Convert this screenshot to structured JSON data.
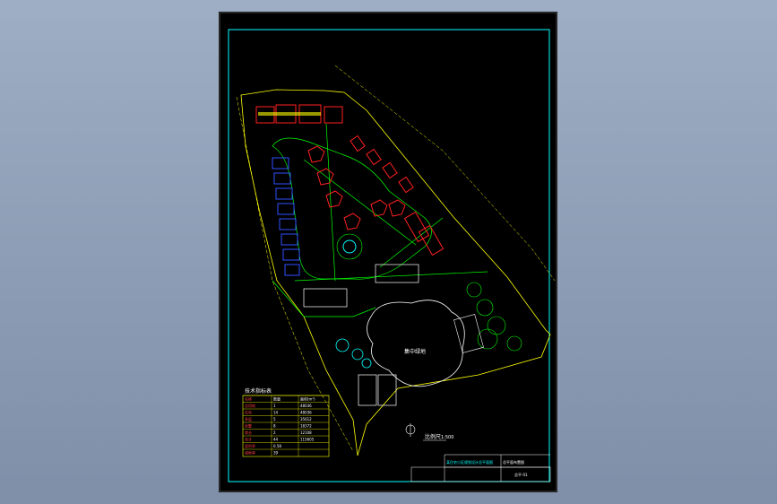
{
  "drawing": {
    "plaza_label": "集中绿地",
    "scale_label": "比例尺",
    "scale_value": "1:500",
    "north_label": "N"
  },
  "table": {
    "title": "技术指标表",
    "headers": [
      "名称",
      "数量",
      "面积(m²)"
    ],
    "rows": [
      [
        "总用地",
        "1",
        "48036"
      ],
      [
        "住宅",
        "14",
        "48036"
      ],
      [
        "多层",
        "5",
        "35612"
      ],
      [
        "别墅",
        "8",
        "18372"
      ],
      [
        "商业",
        "2",
        "12108"
      ],
      [
        "合计",
        "44",
        "115605"
      ],
      [
        "容积率",
        "0.58",
        ""
      ],
      [
        "绿地率",
        "39",
        ""
      ]
    ]
  },
  "title_block": {
    "project": "某住宅小区规划设计总平面图",
    "drawing_name": "总平面布置图",
    "drawing_no": "总平-01"
  },
  "colors": {
    "frame": "#00ffff",
    "boundary": "#ffff00",
    "roads": "#00ff00",
    "buildings_red": "#ff2020",
    "buildings_blue": "#3050ff",
    "text": "#ffffff"
  }
}
